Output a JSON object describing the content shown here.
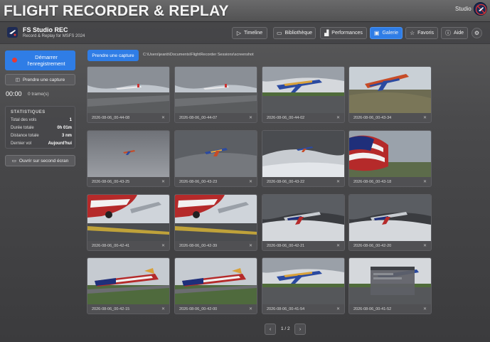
{
  "titlebar": {
    "title": "FLIGHT RECORDER & REPLAY",
    "studio_label": "Studio"
  },
  "header": {
    "brand_name": "FS Studio REC",
    "brand_subtitle": "Record & Replay for MSFS 2024",
    "nav": [
      {
        "label": "Timeline",
        "icon": "play-icon",
        "active": false
      },
      {
        "label": "Bibliothèque",
        "icon": "folder-icon",
        "active": false
      },
      {
        "label": "Performances",
        "icon": "chart-icon",
        "active": false
      },
      {
        "label": "Galerie",
        "icon": "image-icon",
        "active": true
      },
      {
        "label": "Favoris",
        "icon": "star-icon",
        "active": false
      },
      {
        "label": "Aide",
        "icon": "help-icon",
        "active": false
      }
    ]
  },
  "sidebar": {
    "record_label": "Démarrer l'enregistrement",
    "capture_label": "Prendre une capture",
    "timer": "00:00",
    "frames": "0 trame(s)",
    "stats_title": "STATISTIQUES",
    "stats": [
      {
        "label": "Total des vols",
        "value": "1"
      },
      {
        "label": "Durée totale",
        "value": "0h 01m"
      },
      {
        "label": "Distance totale",
        "value": "3 nm"
      },
      {
        "label": "Dernier vol",
        "value": "Aujourd'hui"
      }
    ],
    "second_screen_label": "Ouvrir sur second écran"
  },
  "main": {
    "capture_label": "Prendre une capture",
    "path": "C:\\Users\\jeanb\\Documents\\FlightRecorder Sessions\\screenshot"
  },
  "gallery": [
    {
      "name": "2026-08-06_00-44-08",
      "scene": "runway-cloudy"
    },
    {
      "name": "2026-08-06_00-44-07",
      "scene": "runway-cloudy"
    },
    {
      "name": "2026-08-06_00-44-02",
      "scene": "runway-sw-takeoff"
    },
    {
      "name": "2026-08-06_00-43-34",
      "scene": "sw-climb-ground"
    },
    {
      "name": "2026-08-06_00-43-25",
      "scene": "sky-small-plane"
    },
    {
      "name": "2026-08-06_00-43-23",
      "scene": "sky-sw-plane"
    },
    {
      "name": "2026-08-06_00-43-22",
      "scene": "sky-clouds-plane"
    },
    {
      "name": "2026-08-06_00-43-18",
      "scene": "flag-closeup"
    },
    {
      "name": "2026-08-06_00-42-41",
      "scene": "underbelly"
    },
    {
      "name": "2026-08-06_00-42-39",
      "scene": "underbelly"
    },
    {
      "name": "2026-08-06_00-42-21",
      "scene": "storm-flag-plane"
    },
    {
      "name": "2026-08-06_00-42-20",
      "scene": "storm-flag-plane"
    },
    {
      "name": "2026-08-06_00-42-15",
      "scene": "flag-low-green"
    },
    {
      "name": "2026-08-06_00-42-00",
      "scene": "flag-low-green"
    },
    {
      "name": "2026-08-06_00-41-54",
      "scene": "runway-sw-takeoff"
    },
    {
      "name": "2026-08-06_00-41-52",
      "scene": "runway-window"
    }
  ],
  "pager": {
    "text": "1 / 2",
    "prev": "‹",
    "next": "›"
  }
}
